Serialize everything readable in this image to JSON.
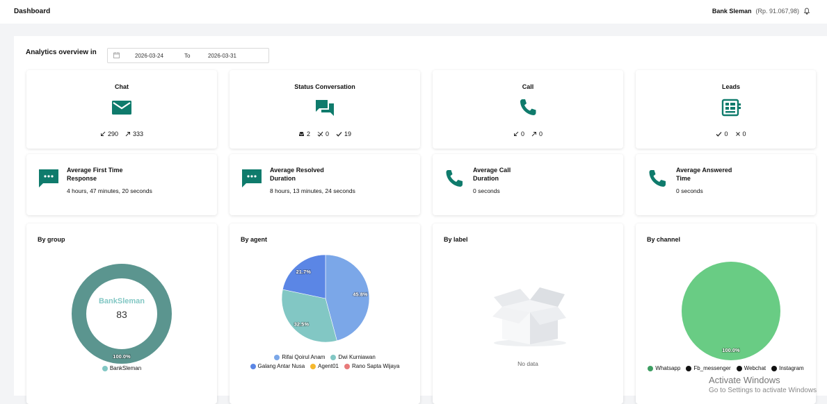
{
  "header": {
    "title": "Dashboard",
    "account_name": "Bank Sleman",
    "balance": "(Rp. 91.067,98)"
  },
  "overview": {
    "label": "Analytics overview in",
    "start_date": "2026-03-24",
    "to_label": "To",
    "end_date": "2026-03-31"
  },
  "summary_cards": {
    "chat": {
      "title": "Chat",
      "icon": "mail-icon",
      "incoming": "290",
      "outgoing": "333"
    },
    "status": {
      "title": "Status Conversation",
      "icon": "chat-bubbles-icon",
      "inbox": "2",
      "unresolved": "0",
      "resolved": "19"
    },
    "call": {
      "title": "Call",
      "icon": "phone-icon",
      "incoming": "0",
      "outgoing": "0"
    },
    "leads": {
      "title": "Leads",
      "icon": "leads-board-icon",
      "won": "0",
      "lost": "0"
    }
  },
  "metrics": {
    "first_response": {
      "title_line1": "Average First Time",
      "title_line2": "Response",
      "value": "4 hours, 47 minutes, 20 seconds"
    },
    "resolved": {
      "title_line1": "Average Resolved",
      "title_line2": "Duration",
      "value": "8 hours, 13 minutes, 24 seconds"
    },
    "call_duration": {
      "title_line1": "Average Call",
      "title_line2": "Duration",
      "value": "0 seconds"
    },
    "answered": {
      "title_line1": "Average Answered",
      "title_line2": "Time",
      "value": "0 seconds"
    }
  },
  "colors": {
    "teal": "#0f7b6c",
    "group_ring": "#5b958f",
    "agent_rifai": "#7ba7e8",
    "agent_dwi": "#82c7c4",
    "agent_galang": "#5b86e5",
    "agent01": "#f5b82e",
    "agent_rano": "#e87a7a",
    "whatsapp": "#69cc84"
  },
  "no_data_text": "No data",
  "watermark": {
    "line1": "Activate Windows",
    "line2": "Go to Settings to activate Windows"
  },
  "chart_data": [
    {
      "type": "pie",
      "variant": "donut",
      "title": "By group",
      "center_label": "BankSleman",
      "center_value": "83",
      "slices": [
        {
          "name": "BankSleman",
          "value": 100.0,
          "label": "100.0%",
          "color": "#5b958f",
          "legend_color": "#82c7c4"
        }
      ],
      "legend": "bottom"
    },
    {
      "type": "pie",
      "title": "By agent",
      "slices": [
        {
          "name": "Rifai Qoirul Anam",
          "value": 45.8,
          "label": "45.8%",
          "color": "#7ba7e8"
        },
        {
          "name": "Dwi Kurniawan",
          "value": 32.5,
          "label": "32.5%",
          "color": "#82c7c4"
        },
        {
          "name": "Galang Antar Nusa",
          "value": 21.7,
          "label": "21.7%",
          "color": "#5b86e5"
        },
        {
          "name": "Agent01",
          "value": 0,
          "label": "",
          "color": "#f5b82e"
        },
        {
          "name": "Rano Sapta Wijaya",
          "value": 0,
          "label": "",
          "color": "#e87a7a"
        }
      ],
      "legend": "bottom"
    },
    {
      "type": "pie",
      "title": "By label",
      "slices": [],
      "legend": "none"
    },
    {
      "type": "pie",
      "title": "By channel",
      "slices": [
        {
          "name": "Whatsapp",
          "value": 100.0,
          "label": "100.0%",
          "color": "#69cc84",
          "legend_color": "#3d9e62"
        },
        {
          "name": "Fb_messenger",
          "value": 0,
          "label": "",
          "color": "#111111"
        },
        {
          "name": "Webchat",
          "value": 0,
          "label": "",
          "color": "#111111"
        },
        {
          "name": "Instagram",
          "value": 0,
          "label": "",
          "color": "#111111"
        }
      ],
      "legend": "bottom"
    }
  ]
}
